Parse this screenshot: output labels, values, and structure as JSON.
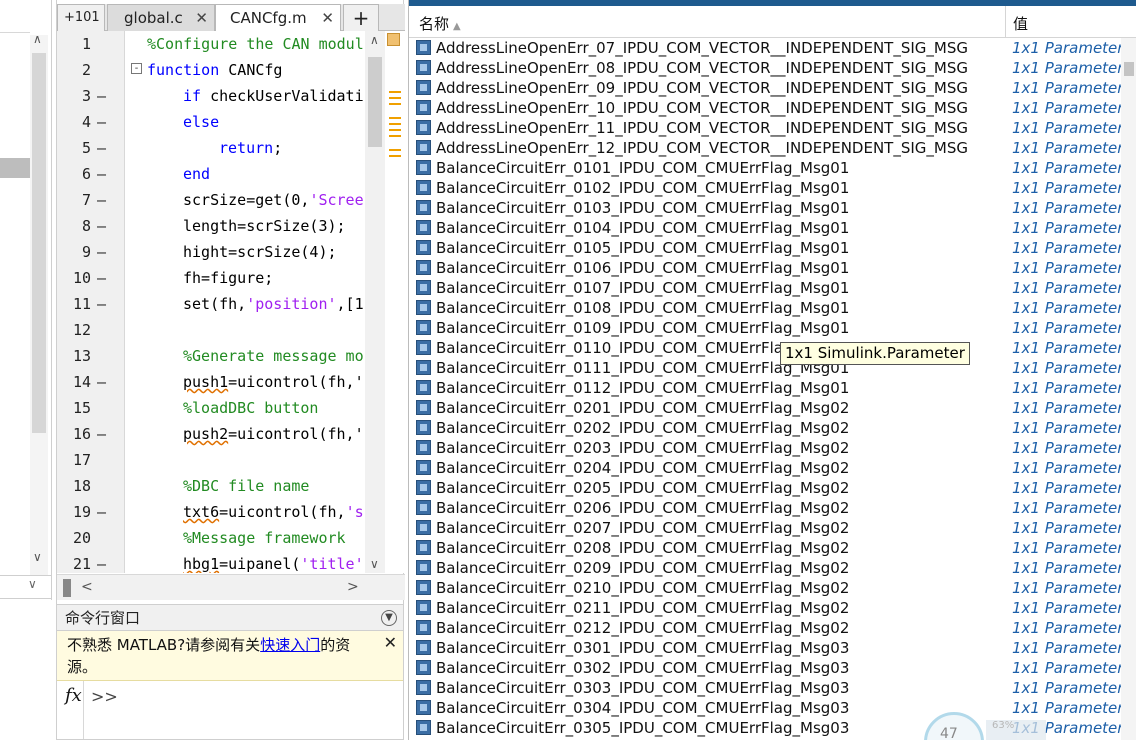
{
  "editor": {
    "tabs": [
      {
        "label": "+101"
      },
      {
        "label": "global.c",
        "close": "✕"
      },
      {
        "label": "CANCfg.m",
        "close": "✕"
      },
      {
        "label": "+"
      }
    ],
    "lines": [
      {
        "n": "1",
        "dash": "",
        "code": [
          {
            "t": "%Configure the CAN modul",
            "c": "cm"
          }
        ],
        "indent": 0
      },
      {
        "n": "2",
        "dash": "",
        "code": [
          {
            "t": "function",
            "c": "kw"
          },
          {
            "t": " CANCfg",
            "c": ""
          }
        ],
        "indent": 0,
        "fold": "-"
      },
      {
        "n": "3",
        "dash": "—",
        "code": [
          {
            "t": "if",
            "c": "kw"
          },
          {
            "t": " checkUserValidati",
            "c": ""
          }
        ],
        "indent": 1
      },
      {
        "n": "4",
        "dash": "—",
        "code": [
          {
            "t": "else",
            "c": "kw"
          }
        ],
        "indent": 1
      },
      {
        "n": "5",
        "dash": "—",
        "code": [
          {
            "t": "return",
            "c": "kw"
          },
          {
            "t": ";",
            "c": ""
          }
        ],
        "indent": 2
      },
      {
        "n": "6",
        "dash": "—",
        "code": [
          {
            "t": "end",
            "c": "kw"
          }
        ],
        "indent": 1
      },
      {
        "n": "7",
        "dash": "—",
        "code": [
          {
            "t": "scrSize=get(0,",
            "c": ""
          },
          {
            "t": "'Scree",
            "c": "st"
          }
        ],
        "indent": 1
      },
      {
        "n": "8",
        "dash": "—",
        "code": [
          {
            "t": "length=scrSize(3);",
            "c": ""
          }
        ],
        "indent": 1
      },
      {
        "n": "9",
        "dash": "—",
        "code": [
          {
            "t": "hight=scrSize(4);",
            "c": ""
          }
        ],
        "indent": 1
      },
      {
        "n": "10",
        "dash": "—",
        "code": [
          {
            "t": "fh=figure;",
            "c": ""
          }
        ],
        "indent": 1
      },
      {
        "n": "11",
        "dash": "—",
        "code": [
          {
            "t": "set(fh,",
            "c": ""
          },
          {
            "t": "'position'",
            "c": "st"
          },
          {
            "t": ",[1",
            "c": ""
          }
        ],
        "indent": 1
      },
      {
        "n": "12",
        "dash": "",
        "code": [],
        "indent": 1
      },
      {
        "n": "13",
        "dash": "",
        "code": [
          {
            "t": "%Generate message mo",
            "c": "cm"
          }
        ],
        "indent": 1
      },
      {
        "n": "14",
        "dash": "—",
        "code": [
          {
            "t": "push1",
            "c": "ul"
          },
          {
            "t": "=uicontrol(fh,'",
            "c": ""
          }
        ],
        "indent": 1
      },
      {
        "n": "15",
        "dash": "",
        "code": [
          {
            "t": "%loadDBC button",
            "c": "cm"
          }
        ],
        "indent": 1
      },
      {
        "n": "16",
        "dash": "—",
        "code": [
          {
            "t": "push2",
            "c": "ul"
          },
          {
            "t": "=uicontrol(fh,'",
            "c": ""
          }
        ],
        "indent": 1
      },
      {
        "n": "17",
        "dash": "",
        "code": [],
        "indent": 1
      },
      {
        "n": "18",
        "dash": "",
        "code": [
          {
            "t": "%DBC file name",
            "c": "cm"
          }
        ],
        "indent": 1
      },
      {
        "n": "19",
        "dash": "—",
        "code": [
          {
            "t": "txt6",
            "c": "ul"
          },
          {
            "t": "=uicontrol(fh,",
            "c": ""
          },
          {
            "t": "'s",
            "c": "st"
          }
        ],
        "indent": 1
      },
      {
        "n": "20",
        "dash": "",
        "code": [
          {
            "t": "%Message framework",
            "c": "cm"
          }
        ],
        "indent": 1
      },
      {
        "n": "21",
        "dash": "—",
        "code": [
          {
            "t": "hbg1",
            "c": "ul"
          },
          {
            "t": "=uipanel(",
            "c": ""
          },
          {
            "t": "'title'",
            "c": "st"
          }
        ],
        "indent": 1
      }
    ]
  },
  "command_window": {
    "title": "命令行窗口",
    "notice_pre": "不熟悉 MATLAB?请参阅有关",
    "notice_link": "快速入门",
    "notice_post": "的资源。",
    "close": "✕",
    "fx": "fx",
    "prompt": ">>"
  },
  "workspace": {
    "col_name": "名称",
    "col_value": "值",
    "rows": [
      {
        "name": "AddressLineOpenErr_07_IPDU_COM_VECTOR__INDEPENDENT_SIG_MSG",
        "value": "1x1 Parameter"
      },
      {
        "name": "AddressLineOpenErr_08_IPDU_COM_VECTOR__INDEPENDENT_SIG_MSG",
        "value": "1x1 Parameter"
      },
      {
        "name": "AddressLineOpenErr_09_IPDU_COM_VECTOR__INDEPENDENT_SIG_MSG",
        "value": "1x1 Parameter"
      },
      {
        "name": "AddressLineOpenErr_10_IPDU_COM_VECTOR__INDEPENDENT_SIG_MSG",
        "value": "1x1 Parameter"
      },
      {
        "name": "AddressLineOpenErr_11_IPDU_COM_VECTOR__INDEPENDENT_SIG_MSG",
        "value": "1x1 Parameter"
      },
      {
        "name": "AddressLineOpenErr_12_IPDU_COM_VECTOR__INDEPENDENT_SIG_MSG",
        "value": "1x1 Parameter"
      },
      {
        "name": "BalanceCircuitErr_0101_IPDU_COM_CMUErrFlag_Msg01",
        "value": "1x1 Parameter"
      },
      {
        "name": "BalanceCircuitErr_0102_IPDU_COM_CMUErrFlag_Msg01",
        "value": "1x1 Parameter"
      },
      {
        "name": "BalanceCircuitErr_0103_IPDU_COM_CMUErrFlag_Msg01",
        "value": "1x1 Parameter"
      },
      {
        "name": "BalanceCircuitErr_0104_IPDU_COM_CMUErrFlag_Msg01",
        "value": "1x1 Parameter"
      },
      {
        "name": "BalanceCircuitErr_0105_IPDU_COM_CMUErrFlag_Msg01",
        "value": "1x1 Parameter"
      },
      {
        "name": "BalanceCircuitErr_0106_IPDU_COM_CMUErrFlag_Msg01",
        "value": "1x1 Parameter"
      },
      {
        "name": "BalanceCircuitErr_0107_IPDU_COM_CMUErrFlag_Msg01",
        "value": "1x1 Parameter"
      },
      {
        "name": "BalanceCircuitErr_0108_IPDU_COM_CMUErrFlag_Msg01",
        "value": "1x1 Parameter"
      },
      {
        "name": "BalanceCircuitErr_0109_IPDU_COM_CMUErrFlag_Msg01",
        "value": "1x1 Parameter"
      },
      {
        "name": "BalanceCircuitErr_0110_IPDU_COM_CMUErrFlag_Msg01",
        "value": "1x1 Parameter"
      },
      {
        "name": "BalanceCircuitErr_0111_IPDU_COM_CMUErrFlag_Msg01",
        "value": "1x1 Parameter"
      },
      {
        "name": "BalanceCircuitErr_0112_IPDU_COM_CMUErrFlag_Msg01",
        "value": "1x1 Parameter"
      },
      {
        "name": "BalanceCircuitErr_0201_IPDU_COM_CMUErrFlag_Msg02",
        "value": "1x1 Parameter"
      },
      {
        "name": "BalanceCircuitErr_0202_IPDU_COM_CMUErrFlag_Msg02",
        "value": "1x1 Parameter"
      },
      {
        "name": "BalanceCircuitErr_0203_IPDU_COM_CMUErrFlag_Msg02",
        "value": "1x1 Parameter"
      },
      {
        "name": "BalanceCircuitErr_0204_IPDU_COM_CMUErrFlag_Msg02",
        "value": "1x1 Parameter"
      },
      {
        "name": "BalanceCircuitErr_0205_IPDU_COM_CMUErrFlag_Msg02",
        "value": "1x1 Parameter"
      },
      {
        "name": "BalanceCircuitErr_0206_IPDU_COM_CMUErrFlag_Msg02",
        "value": "1x1 Parameter"
      },
      {
        "name": "BalanceCircuitErr_0207_IPDU_COM_CMUErrFlag_Msg02",
        "value": "1x1 Parameter"
      },
      {
        "name": "BalanceCircuitErr_0208_IPDU_COM_CMUErrFlag_Msg02",
        "value": "1x1 Parameter"
      },
      {
        "name": "BalanceCircuitErr_0209_IPDU_COM_CMUErrFlag_Msg02",
        "value": "1x1 Parameter"
      },
      {
        "name": "BalanceCircuitErr_0210_IPDU_COM_CMUErrFlag_Msg02",
        "value": "1x1 Parameter"
      },
      {
        "name": "BalanceCircuitErr_0211_IPDU_COM_CMUErrFlag_Msg02",
        "value": "1x1 Parameter"
      },
      {
        "name": "BalanceCircuitErr_0212_IPDU_COM_CMUErrFlag_Msg02",
        "value": "1x1 Parameter"
      },
      {
        "name": "BalanceCircuitErr_0301_IPDU_COM_CMUErrFlag_Msg03",
        "value": "1x1 Parameter"
      },
      {
        "name": "BalanceCircuitErr_0302_IPDU_COM_CMUErrFlag_Msg03",
        "value": "1x1 Parameter"
      },
      {
        "name": "BalanceCircuitErr_0303_IPDU_COM_CMUErrFlag_Msg03",
        "value": "1x1 Parameter"
      },
      {
        "name": "BalanceCircuitErr_0304_IPDU_COM_CMUErrFlag_Msg03",
        "value": "1x1 Parameter"
      },
      {
        "name": "BalanceCircuitErr_0305_IPDU_COM_CMUErrFlag_Msg03",
        "value": "1x1 Parameter"
      }
    ],
    "tooltip": "1x1 Simulink.Parameter"
  },
  "widget": {
    "number": "47",
    "small": "63%"
  }
}
